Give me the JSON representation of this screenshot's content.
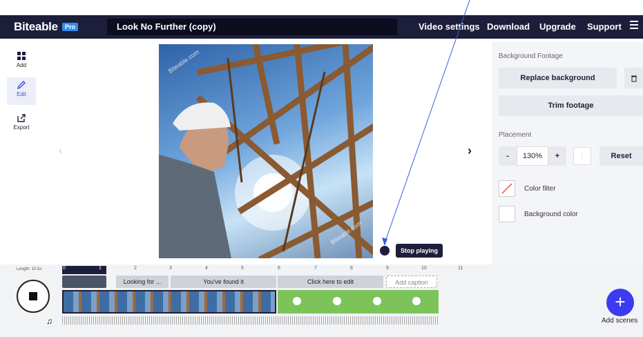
{
  "header": {
    "brand": "Biteable",
    "badge": "Pro",
    "project_title": "Look No Further (copy)",
    "nav": {
      "video_settings": "Video settings",
      "download": "Download",
      "upgrade": "Upgrade",
      "support": "Support"
    }
  },
  "rail": {
    "items": [
      {
        "label": "Add",
        "icon": "grid-icon"
      },
      {
        "label": "Edit",
        "icon": "pencil-icon"
      },
      {
        "label": "Export",
        "icon": "export-icon"
      }
    ]
  },
  "canvas": {
    "watermark_text": "Biteable.com",
    "tooltip": "Stop playing"
  },
  "panel": {
    "background_footage_label": "Background Footage",
    "replace_background": "Replace background",
    "trim_footage": "Trim footage",
    "placement_label": "Placement",
    "minus": "-",
    "zoom": "130%",
    "plus": "+",
    "reset": "Reset",
    "color_filter": "Color filter",
    "background_color": "Background color"
  },
  "timeline": {
    "length_label": "Length: 10.5s",
    "ticks": [
      "0",
      "1",
      "2",
      "3",
      "4",
      "5",
      "6",
      "7",
      "8",
      "9",
      "10",
      "11"
    ],
    "captions": {
      "looking_for": "Looking for ...",
      "found_it": "You've found it",
      "click_to_edit": "Click here to edit",
      "add_caption": "Add caption"
    },
    "add_scenes": "Add scenes"
  },
  "colors": {
    "topbar": "#1d1e3a",
    "accent": "#3d3bf0",
    "green_scene": "#7cc35a",
    "badge": "#2e8ef0"
  }
}
